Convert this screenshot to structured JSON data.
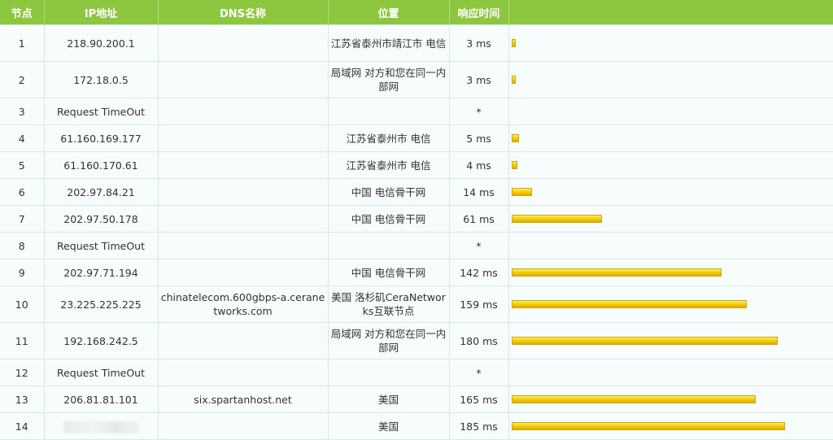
{
  "headers": {
    "hop": "节点",
    "ip": "IP地址",
    "dns": "DNS名称",
    "location": "位置",
    "time": "响应时间",
    "bar": ""
  },
  "max_time_ms": 185,
  "rows": [
    {
      "hop": "1",
      "ip": "218.90.200.1",
      "dns": "",
      "location": "江苏省泰州市靖江市 电信",
      "time": "3 ms",
      "time_ms": 3,
      "tall": true
    },
    {
      "hop": "2",
      "ip": "172.18.0.5",
      "dns": "",
      "location": "局域网 对方和您在同一内部网",
      "time": "3 ms",
      "time_ms": 3,
      "tall": true
    },
    {
      "hop": "3",
      "ip": "Request TimeOut",
      "dns": "",
      "location": "",
      "time": "*",
      "time_ms": null,
      "tall": false
    },
    {
      "hop": "4",
      "ip": "61.160.169.177",
      "dns": "",
      "location": "江苏省泰州市 电信",
      "time": "5 ms",
      "time_ms": 5,
      "tall": false
    },
    {
      "hop": "5",
      "ip": "61.160.170.61",
      "dns": "",
      "location": "江苏省泰州市 电信",
      "time": "4 ms",
      "time_ms": 4,
      "tall": false
    },
    {
      "hop": "6",
      "ip": "202.97.84.21",
      "dns": "",
      "location": "中国 电信骨干网",
      "time": "14 ms",
      "time_ms": 14,
      "tall": false
    },
    {
      "hop": "7",
      "ip": "202.97.50.178",
      "dns": "",
      "location": "中国 电信骨干网",
      "time": "61 ms",
      "time_ms": 61,
      "tall": false
    },
    {
      "hop": "8",
      "ip": "Request TimeOut",
      "dns": "",
      "location": "",
      "time": "*",
      "time_ms": null,
      "tall": false
    },
    {
      "hop": "9",
      "ip": "202.97.71.194",
      "dns": "",
      "location": "中国 电信骨干网",
      "time": "142 ms",
      "time_ms": 142,
      "tall": false
    },
    {
      "hop": "10",
      "ip": "23.225.225.225",
      "dns": "chinatelecom.600gbps-a.ceranetworks.com",
      "location": "美国 洛杉矶CeraNetworks互联节点",
      "time": "159 ms",
      "time_ms": 159,
      "tall": true
    },
    {
      "hop": "11",
      "ip": "192.168.242.5",
      "dns": "",
      "location": "局域网 对方和您在同一内部网",
      "time": "180 ms",
      "time_ms": 180,
      "tall": true
    },
    {
      "hop": "12",
      "ip": "Request TimeOut",
      "dns": "",
      "location": "",
      "time": "*",
      "time_ms": null,
      "tall": false
    },
    {
      "hop": "13",
      "ip": "206.81.81.101",
      "dns": "six.spartanhost.net",
      "location": "美国",
      "time": "165 ms",
      "time_ms": 165,
      "tall": false
    },
    {
      "hop": "14",
      "ip": "",
      "ip_masked": true,
      "dns": "",
      "location": "美国",
      "time": "185 ms",
      "time_ms": 185,
      "tall": false
    }
  ]
}
